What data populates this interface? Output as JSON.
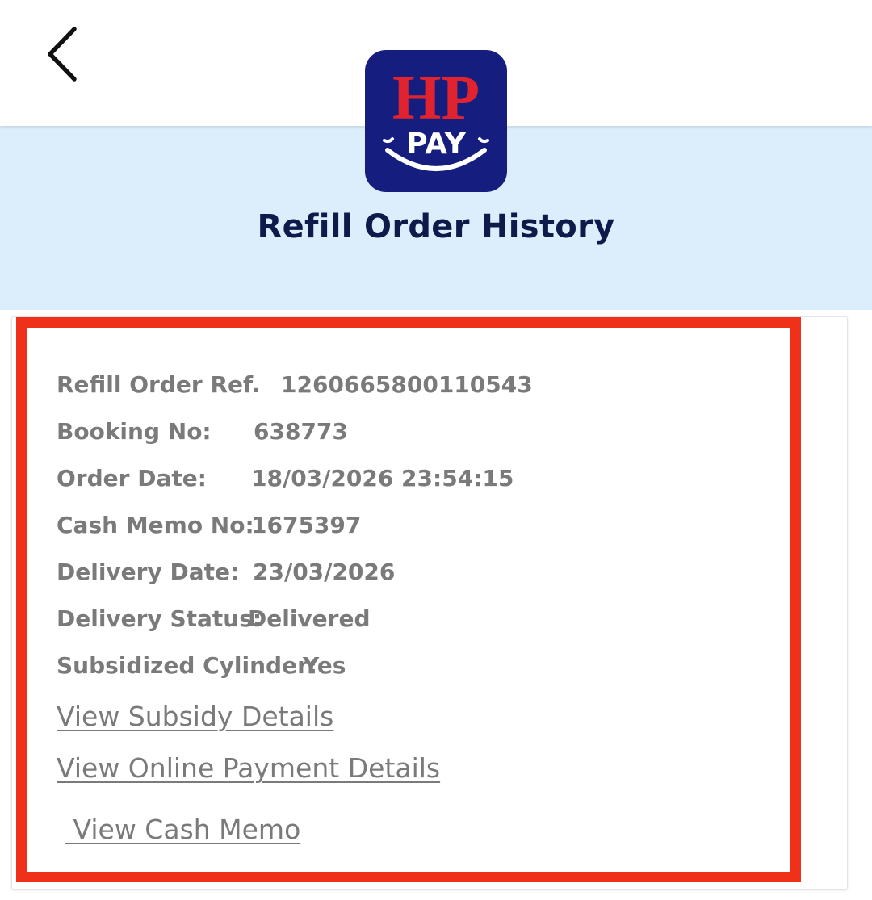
{
  "header": {
    "back_icon": "chevron-left-icon",
    "logo": {
      "brand_text": "HP",
      "pay_text": "PAY",
      "background_color": "#151e7e",
      "brand_color": "#e0232f"
    }
  },
  "page": {
    "title": "Refill Order History",
    "band_color": "#dcedfb"
  },
  "order": {
    "highlight_color": "#f0311a",
    "fields": [
      {
        "label": "Refill Order Ref.",
        "value": "1260665800110543"
      },
      {
        "label": "Booking No:",
        "value": "638773"
      },
      {
        "label": "Order Date:",
        "value": "18/03/2026 23:54:15"
      },
      {
        "label": "Cash Memo No:",
        "value": "1675397"
      },
      {
        "label": "Delivery Date:",
        "value": "23/03/2026"
      },
      {
        "label": "Delivery Status:",
        "value": "Delivered"
      },
      {
        "label": "Subsidized Cylinder:",
        "value": "Yes"
      }
    ],
    "links": {
      "subsidy": "View Subsidy Details",
      "online_payment": "View Online Payment Details",
      "cash_memo": "View Cash Memo"
    }
  }
}
